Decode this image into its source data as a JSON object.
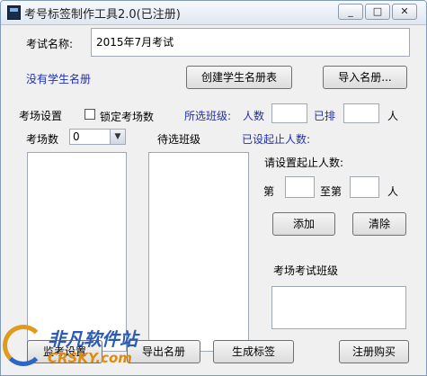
{
  "window": {
    "title": "考号标签制作工具2.0(已注册)",
    "min_glyph": "_",
    "max_glyph": "□",
    "close_glyph": "✕"
  },
  "exam": {
    "name_label": "考试名称:",
    "name_value": "2015年7月考试"
  },
  "students": {
    "status": "没有学生名册",
    "create_button": "创建学生名册表",
    "import_button": "导入名册..."
  },
  "rooms": {
    "section_label": "考场设置",
    "lock_label": "锁定考场数",
    "count_label": "考场数",
    "count_value": "0",
    "selected_class_label": "所选班级:",
    "people_label": "人数",
    "arranged_label": "已排",
    "person_unit": "人",
    "pending_class_label": "待选班级",
    "range_set_label": "已设起止人数:",
    "please_set_label": "请设置起止人数:",
    "from_label": "第",
    "to_label": "至第",
    "to_unit": "人",
    "add_button": "添加",
    "clear_button": "清除",
    "exam_room_class_label": "考场考试班级"
  },
  "footer": {
    "room_settings_button": "监考设置",
    "export_list_button": "导出名册",
    "generate_labels_button": "生成标签",
    "register_button": "注册购买"
  },
  "watermark": {
    "brand_cn": "非凡软件站",
    "brand_en": "CRSKY.com"
  },
  "colors": {
    "accent_text": "#1f2fb0",
    "window_bg": "#f0f0f0"
  }
}
